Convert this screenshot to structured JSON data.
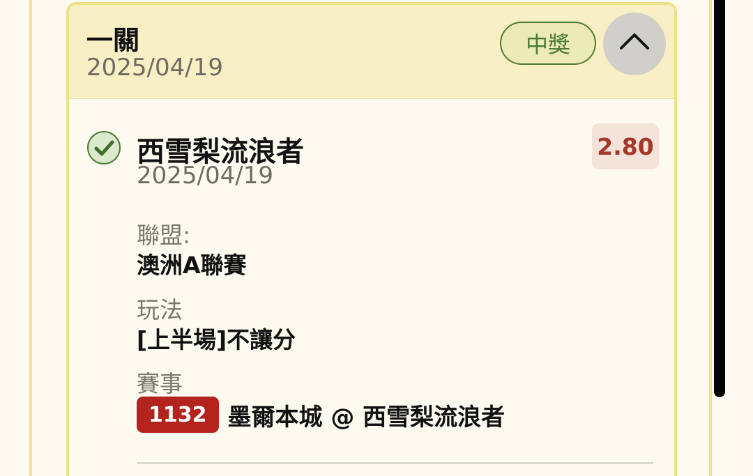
{
  "bet_card": {
    "title": "一關",
    "date": "2025/04/19",
    "status": "中獎",
    "collapse_icon": "chevron-up-icon",
    "colors": {
      "header_bg": "#f8f0c4",
      "border": "#efe08a",
      "win_green": "#4d7a34",
      "odds_red": "#a3372a",
      "match_badge_red": "#b2241d"
    }
  },
  "selection": {
    "result_icon": "check-circle-icon",
    "team": "西雪梨流浪者",
    "date": "2025/04/19",
    "odds": "2.80",
    "league_label": "聯盟:",
    "league_value": "澳洲A聯賽",
    "play_label": "玩法",
    "play_value": "[上半場]不讓分",
    "match_label": "賽事",
    "match_id": "1132",
    "match_teams": "墨爾本城 @ 西雪梨流浪者"
  }
}
